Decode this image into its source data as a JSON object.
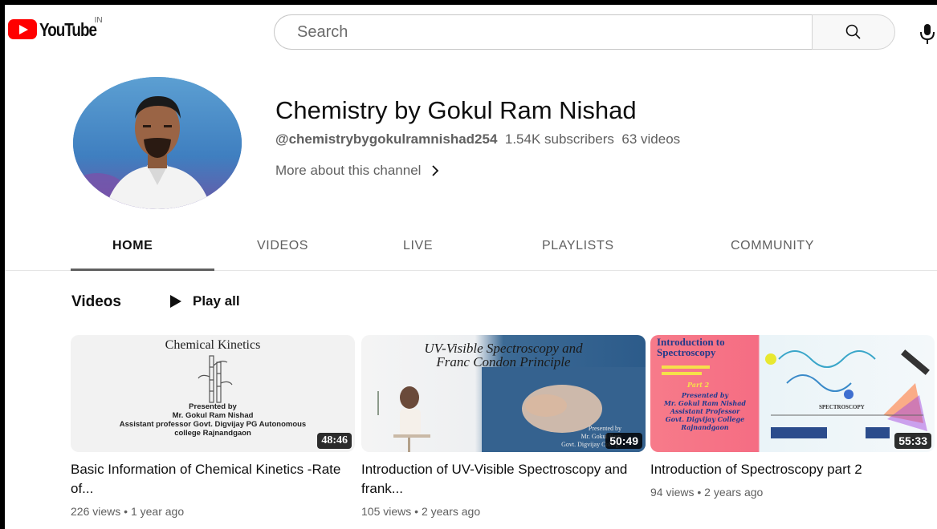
{
  "header": {
    "logo_text": "YouTube",
    "country_code": "IN",
    "search_placeholder": "Search"
  },
  "channel": {
    "name": "Chemistry by Gokul Ram Nishad",
    "handle": "@chemistrybygokulramnishad254",
    "subscribers": "1.54K subscribers",
    "video_count": "63 videos",
    "more_about": "More about this channel"
  },
  "tabs": [
    {
      "label": "HOME",
      "active": true
    },
    {
      "label": "VIDEOS",
      "active": false
    },
    {
      "label": "LIVE",
      "active": false
    },
    {
      "label": "PLAYLISTS",
      "active": false
    },
    {
      "label": "COMMUNITY",
      "active": false
    }
  ],
  "shelf": {
    "title": "Videos",
    "play_all": "Play all"
  },
  "videos": [
    {
      "title": "Basic Information of Chemical Kinetics -Rate of...",
      "duration": "48:46",
      "views": "226 views",
      "age": "1 year ago",
      "thumb": {
        "heading": "Chemical Kinetics",
        "presented_by": "Presented by",
        "presenter": "Mr. Gokul Ram Nishad",
        "role": "Assistant professor Govt. Digvijay PG Autonomous",
        "college": "college Rajnandgaon"
      }
    },
    {
      "title": "Introduction of UV-Visible Spectroscopy and frank...",
      "duration": "50:49",
      "views": "105 views",
      "age": "2 years ago",
      "thumb": {
        "heading_line1": "UV-Visible Spectroscopy and",
        "heading_line2": "Franc Condon Principle",
        "presented_by": "Presented by",
        "presenter": "Mr. Gokul Ram",
        "college": "Govt. Digvijay College"
      }
    },
    {
      "title": "Introduction of Spectroscopy part 2",
      "duration": "55:33",
      "views": "94 views",
      "age": "2 years ago",
      "thumb": {
        "heading_line1": "Introduction to",
        "heading_line2": "Spectroscopy",
        "part": "Part 2",
        "presented_by": "Presented by",
        "presenter": "Mr. Gokul Ram Nishad",
        "role": "Assistant Professor",
        "college": "Govt. Digvijay College",
        "city": "Rajnandgaon",
        "diagram_label": "SPECTROSCOPY"
      }
    }
  ],
  "colors": {
    "brand_red": "#ff0000",
    "text_primary": "#0f0f0f",
    "text_secondary": "#606060"
  }
}
